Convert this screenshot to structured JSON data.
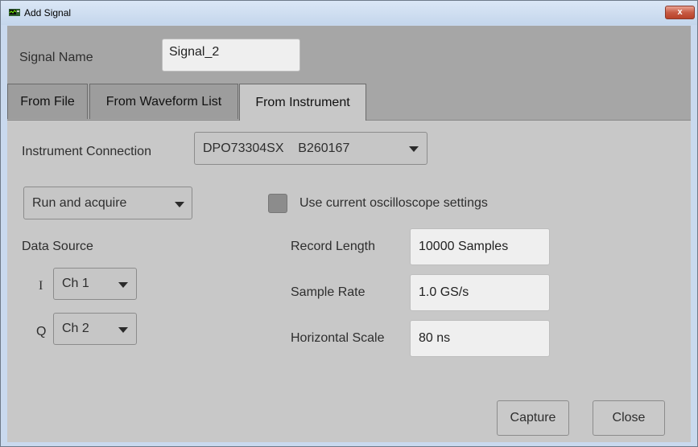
{
  "window": {
    "title": "Add Signal",
    "close_glyph": "x"
  },
  "signal_name": {
    "label": "Signal Name",
    "value": "Signal_2"
  },
  "tabs": [
    {
      "label": "From File",
      "active": false
    },
    {
      "label": "From Waveform List",
      "active": false
    },
    {
      "label": "From Instrument",
      "active": true
    }
  ],
  "instrument": {
    "connection_label": "Instrument Connection",
    "connection_value": "DPO73304SX    B260167",
    "mode_value": "Run and acquire",
    "use_current_label": "Use current oscilloscope settings",
    "use_current_checked": false,
    "data_source_label": "Data Source",
    "i_label": "I",
    "i_value": "Ch 1",
    "q_label": "Q",
    "q_value": "Ch 2",
    "record_length_label": "Record Length",
    "record_length_value": "10000 Samples",
    "sample_rate_label": "Sample Rate",
    "sample_rate_value": "1.0 GS/s",
    "horizontal_scale_label": "Horizontal Scale",
    "horizontal_scale_value": "80 ns"
  },
  "buttons": {
    "capture": "Capture",
    "close": "Close"
  },
  "icons": {
    "app": "oscilloscope-icon",
    "caret": "chevron-down-icon"
  },
  "colors": {
    "panel": "#c8c8c8",
    "background": "#a6a6a6",
    "titlebar": "#c9d9ee",
    "close": "#c75a43"
  }
}
